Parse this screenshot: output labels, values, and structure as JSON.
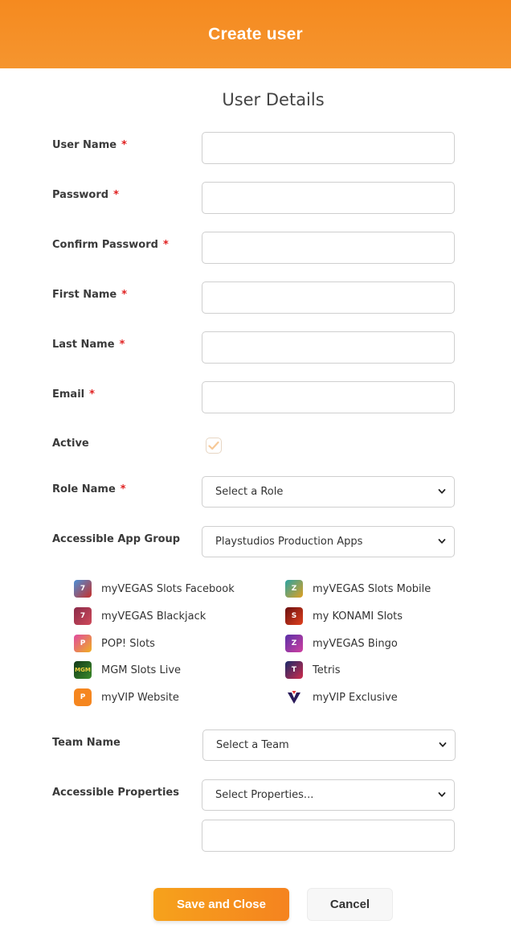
{
  "header": {
    "title": "Create user"
  },
  "section_title": "User Details",
  "required_mark": "*",
  "fields": {
    "user_name": {
      "label": "User Name",
      "value": ""
    },
    "password": {
      "label": "Password",
      "value": ""
    },
    "confirm_password": {
      "label": "Confirm Password",
      "value": ""
    },
    "first_name": {
      "label": "First Name",
      "value": ""
    },
    "last_name": {
      "label": "Last Name",
      "value": ""
    },
    "email": {
      "label": "Email",
      "value": ""
    },
    "active": {
      "label": "Active",
      "checked": true
    },
    "role_name": {
      "label": "Role Name",
      "selected": "Select a Role"
    },
    "app_group": {
      "label": "Accessible App Group",
      "selected": "Playstudios Production Apps"
    },
    "team_name": {
      "label": "Team Name",
      "selected": "Select a Team"
    },
    "properties": {
      "label": "Accessible Properties",
      "selected": "Select Properties...",
      "extra_value": ""
    }
  },
  "apps": [
    {
      "name": "myVEGAS Slots Facebook",
      "icon": "slots-facebook-icon",
      "color": "#3a6fb8"
    },
    {
      "name": "myVEGAS Slots Mobile",
      "icon": "slots-mobile-icon",
      "color": "#2a7f8a"
    },
    {
      "name": "myVEGAS Blackjack",
      "icon": "blackjack-icon",
      "color": "#8a2b4a"
    },
    {
      "name": "my KONAMI Slots",
      "icon": "konami-slots-icon",
      "color": "#b3261e"
    },
    {
      "name": "POP! Slots",
      "icon": "pop-slots-icon",
      "color": "#c8409a"
    },
    {
      "name": "myVEGAS Bingo",
      "icon": "bingo-icon",
      "color": "#6a3fb3"
    },
    {
      "name": "MGM Slots Live",
      "icon": "mgm-slots-icon",
      "color": "#1f5a2a"
    },
    {
      "name": "Tetris",
      "icon": "tetris-icon",
      "color": "#2a3a8a"
    },
    {
      "name": "myVIP Website",
      "icon": "myvip-website-icon",
      "color": "#f5861f"
    },
    {
      "name": "myVIP Exclusive",
      "icon": "myvip-exclusive-icon",
      "color": "#5a2a8a"
    }
  ],
  "buttons": {
    "save": "Save and Close",
    "cancel": "Cancel"
  },
  "colors": {
    "accent": "#f58a1f",
    "required": "#e02020"
  }
}
